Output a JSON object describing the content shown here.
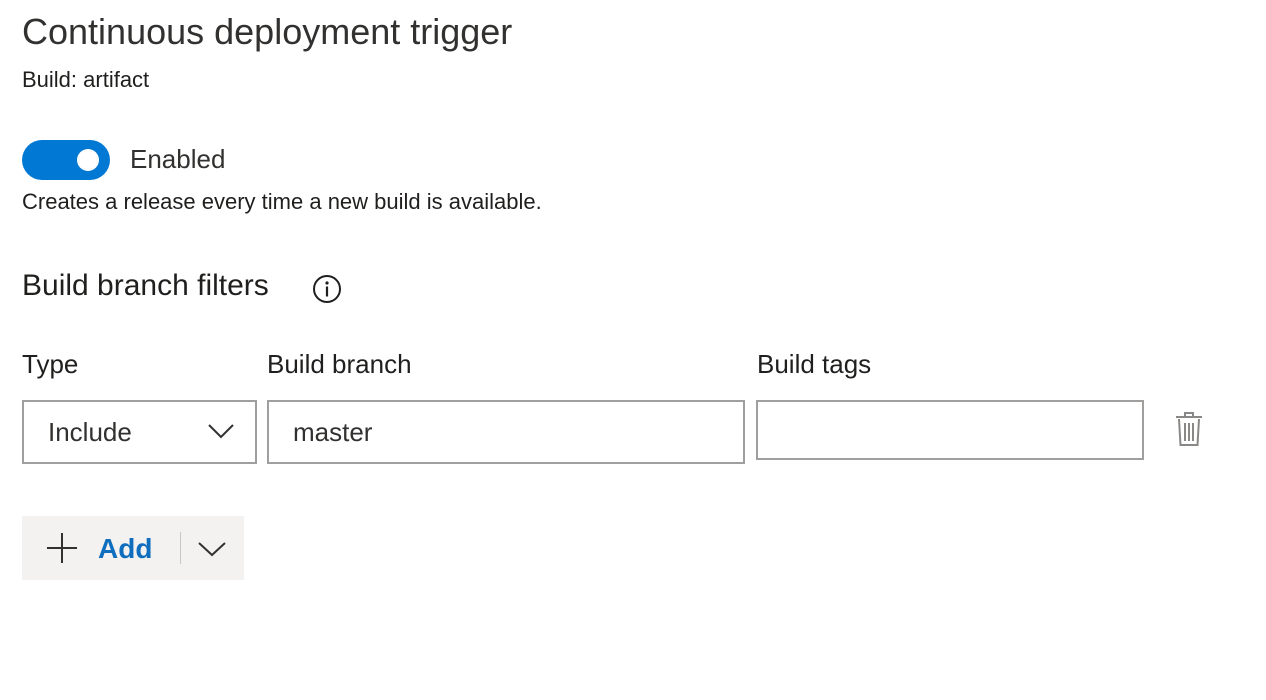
{
  "header": {
    "title": "Continuous deployment trigger",
    "artifact_label": "Build: artifact"
  },
  "trigger": {
    "enabled": true,
    "toggle_label": "Enabled",
    "description": "Creates a release every time a new build is available."
  },
  "filters": {
    "section_title": "Build branch filters",
    "info_icon": "info-icon",
    "columns": {
      "type": "Type",
      "branch": "Build branch",
      "tags": "Build tags"
    },
    "rows": [
      {
        "type": "Include",
        "branch": "master",
        "tags": ""
      }
    ],
    "delete_icon": "trash-icon"
  },
  "add_button": {
    "label": "Add",
    "plus_icon": "plus-icon",
    "split_icon": "chevron-down-icon"
  },
  "colors": {
    "accent": "#0078d4",
    "link": "#106ebe",
    "border": "#a19f9d",
    "button_bg": "#f3f2f1"
  }
}
